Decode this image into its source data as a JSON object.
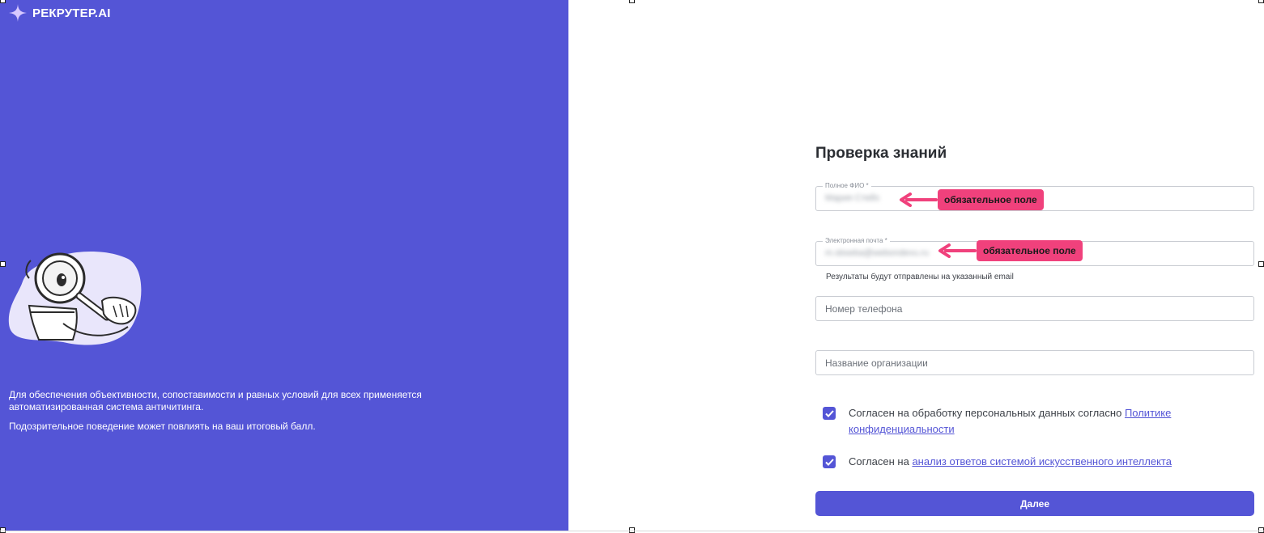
{
  "brand": {
    "name": "РЕКРУТЕР.AI"
  },
  "notice": {
    "line1": "Для обеспечения объективности, сопоставимости и равных условий для всех применяется автоматизированная система античитинга.",
    "line2": "Подозрительное поведение может повлиять на ваш итоговый балл."
  },
  "form": {
    "title": "Проверка знаний",
    "full_name": {
      "label": "Полное ФИО *",
      "value": "Мария Стейз"
    },
    "email": {
      "label": "Электронная почта *",
      "value": "m.sbseba@webondevu.ru",
      "hint": "Результаты будут отправлены на указанный email"
    },
    "phone": {
      "placeholder": "Номер телефона"
    },
    "organization": {
      "placeholder": "Название организации"
    },
    "consent_personal": {
      "text": "Согласен на обработку персональных данных согласно ",
      "link": "Политике конфиденциальности",
      "checked": true
    },
    "consent_ai": {
      "text": "Согласен на ",
      "link": "анализ ответов системой искусственного интеллекта",
      "checked": true
    },
    "next_button": "Далее"
  },
  "annotations": [
    {
      "text": "обязательное поле"
    },
    {
      "text": "обязательное поле"
    }
  ],
  "colors": {
    "accent": "#5455d6",
    "annotation": "#f0417c"
  }
}
